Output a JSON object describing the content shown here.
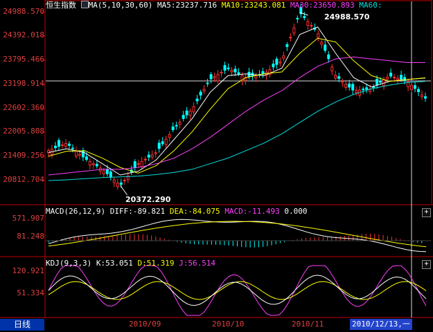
{
  "main_panel": {
    "title": "恒生指数",
    "ma_label": "MA(5,10,30,60)",
    "ma5": "MA5:23237.716",
    "ma10": "MA10:23243.081",
    "ma30": "MA30:23650.893",
    "ma60": "MA60:",
    "y_labels": [
      "24988.570",
      "24392.018",
      "23795.466",
      "23198.914",
      "22602.360",
      "22005.808",
      "21409.256",
      "20812.704"
    ],
    "peak_label": "24988.570",
    "trough_label": "20372.290"
  },
  "macd_panel": {
    "label": "MACD(26,12,9)",
    "diff": "DIFF:-89.821",
    "dea": "DEA:-84.075",
    "macd": "MACD:-11.493",
    "zero": "0.000",
    "y_labels": [
      "571.907",
      "81.248"
    ],
    "button": "+"
  },
  "kdj_panel": {
    "label": "KDJ(9,3,3)",
    "k": "K:53.051",
    "d": "D:51.319",
    "j": "J:56.514",
    "y_labels": [
      "120.921",
      "51.334"
    ],
    "button": "+"
  },
  "footer": {
    "period_tab": "日线",
    "x_labels": [
      "2010/09",
      "2010/10",
      "2010/11"
    ],
    "cursor_date": "2010/12/13,一"
  },
  "chart_data": {
    "type": "line",
    "x": [
      "2010/08/16",
      "2010/08/20",
      "2010/08/26",
      "2010/09/01",
      "2010/09/07",
      "2010/09/13",
      "2010/09/17",
      "2010/09/24",
      "2010/09/30",
      "2010/10/08",
      "2010/10/14",
      "2010/10/20",
      "2010/10/26",
      "2010/11/01",
      "2010/11/05",
      "2010/11/11",
      "2010/11/17",
      "2010/11/23",
      "2010/11/29",
      "2010/12/03",
      "2010/12/09",
      "2010/12/13"
    ],
    "series": [
      {
        "name": "恒生指数",
        "values": [
          21300,
          21500,
          21100,
          20800,
          20372,
          20950,
          21250,
          21900,
          22400,
          23200,
          23500,
          23250,
          23350,
          23700,
          24988,
          24450,
          23300,
          22900,
          22950,
          23300,
          23150,
          22700
        ]
      },
      {
        "name": "MA5",
        "values": [
          21250,
          21350,
          21250,
          20950,
          20650,
          20750,
          21050,
          21600,
          22150,
          22850,
          23300,
          23350,
          23300,
          23500,
          24400,
          24600,
          23900,
          23250,
          23000,
          23150,
          23200,
          23237
        ]
      },
      {
        "name": "MA10",
        "values": [
          21150,
          21280,
          21300,
          21100,
          20850,
          20700,
          20900,
          21300,
          21800,
          22400,
          22950,
          23250,
          23350,
          23400,
          23900,
          24300,
          24200,
          23700,
          23300,
          23150,
          23200,
          23243
        ]
      },
      {
        "name": "MA30",
        "values": [
          20650,
          20700,
          20750,
          20800,
          20800,
          20850,
          20950,
          21100,
          21350,
          21650,
          22000,
          22350,
          22650,
          22900,
          23250,
          23550,
          23750,
          23800,
          23750,
          23700,
          23650,
          23651
        ]
      },
      {
        "name": "MA60",
        "values": [
          20500,
          20520,
          20550,
          20580,
          20600,
          20620,
          20660,
          20720,
          20800,
          20950,
          21100,
          21300,
          21500,
          21750,
          22050,
          22350,
          22600,
          22800,
          22950,
          23050,
          23120,
          23150
        ]
      }
    ],
    "ylim": [
      20372.29,
      24988.57
    ],
    "grid": false
  }
}
